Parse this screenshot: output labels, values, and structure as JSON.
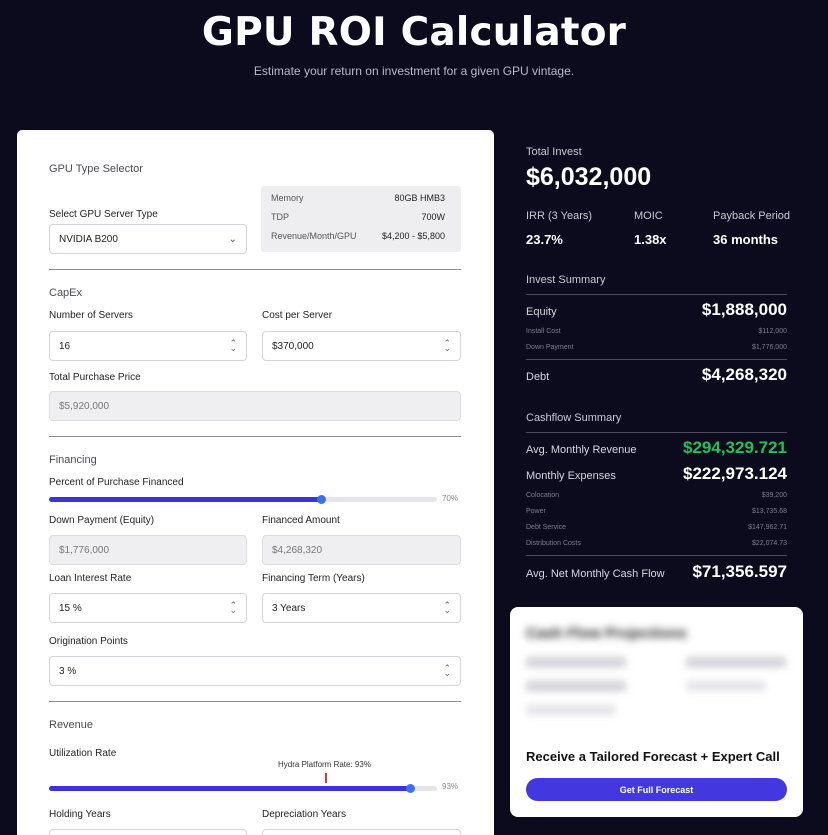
{
  "header": {
    "title": "GPU ROI Calculator",
    "subtitle": "Estimate your return on investment for a given GPU vintage."
  },
  "gpu_type": {
    "section_title": "GPU Type Selector",
    "select_label": "Select GPU Server Type",
    "select_value": "NVIDIA B200",
    "specs": [
      {
        "label": "Memory",
        "value": "80GB HMB3"
      },
      {
        "label": "TDP",
        "value": "700W"
      },
      {
        "label": "Revenue/Month/GPU",
        "value": "$4,200 - $5,800"
      }
    ]
  },
  "capex": {
    "section_title": "CapEx",
    "servers_label": "Number of Servers",
    "servers_value": "16",
    "cost_label": "Cost per Server",
    "cost_value": "$370,000",
    "total_label": "Total Purchase Price",
    "total_value": "$5,920,000"
  },
  "financing": {
    "section_title": "Financing",
    "percent_label": "Percent of Purchase Financed",
    "percent_value": 70,
    "percent_text": "70%",
    "down_label": "Down Payment (Equity)",
    "down_value": "$1,776,000",
    "financed_label": "Financed Amount",
    "financed_value": "$4,268,320",
    "rate_label": "Loan Interest Rate",
    "rate_value": "15 %",
    "term_label": "Financing Term (Years)",
    "term_value": "3 Years",
    "points_label": "Origination Points",
    "points_value": "3 %"
  },
  "revenue": {
    "section_title": "Revenue",
    "utilization_label": "Utilization Rate",
    "utilization_value": 93,
    "utilization_text": "93%",
    "platform_marker_label": "Hydra Platform Rate: 93%",
    "holding_label": "Holding Years",
    "depreciation_label": "Depreciation Years"
  },
  "summary": {
    "total_invest_label": "Total Invest",
    "total_invest_value": "$6,032,000",
    "irr_label": "IRR (3 Years)",
    "irr_value": "23.7%",
    "moic_label": "MOIC",
    "moic_value": "1.38x",
    "payback_label": "Payback Period",
    "payback_value": "36 months"
  },
  "invest_summary": {
    "title": "Invest Summary",
    "equity_label": "Equity",
    "equity_value": "$1,888,000",
    "install_label": "Install Cost",
    "install_value": "$112,000",
    "down_label": "Down Payment",
    "down_value": "$1,776,000",
    "debt_label": "Debt",
    "debt_value": "$4,268,320"
  },
  "cashflow_summary": {
    "title": "Cashflow Summary",
    "revenue_label": "Avg. Monthly Revenue",
    "revenue_value": "$294,329.721",
    "expenses_label": "Monthly Expenses",
    "expenses_value": "$222,973.124",
    "items": [
      {
        "label": "Colocation",
        "value": "$39,200"
      },
      {
        "label": "Power",
        "value": "$13,735.68"
      },
      {
        "label": "Debt Service",
        "value": "$147,962.71"
      },
      {
        "label": "Distribution Costs",
        "value": "$22,074.73"
      }
    ],
    "net_label": "Avg. Net Monthly Cash Flow",
    "net_value": "$71,356.597"
  },
  "forecast": {
    "blurred_title": "Cash Flow Projections",
    "cta_text": "Receive a Tailored Forecast + Expert Call",
    "button_label": "Get Full Forecast"
  },
  "colors": {
    "background": "#0c0b1d",
    "accent": "#3b33d9",
    "positive": "#21c05a"
  }
}
